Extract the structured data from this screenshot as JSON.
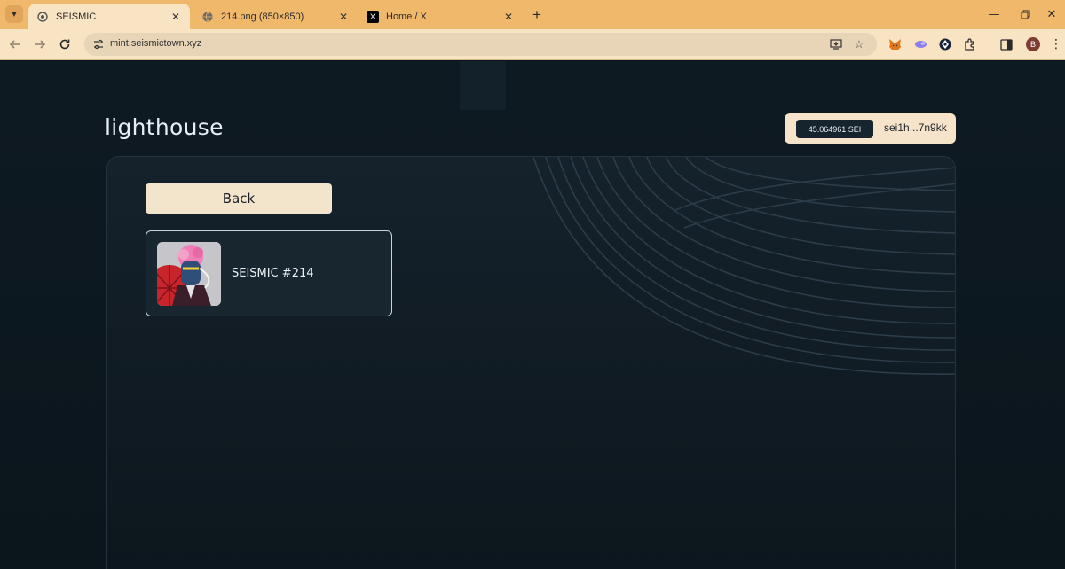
{
  "browser": {
    "tabs": [
      {
        "title": "SEISMIC",
        "active": true
      },
      {
        "title": "214.png (850×850)",
        "active": false
      },
      {
        "title": "Home / X",
        "active": false
      }
    ],
    "url": "mint.seismictown.xyz",
    "profile_initial": "B"
  },
  "app": {
    "logo": "lighthouse",
    "wallet": {
      "balance": "45.064961 SEI",
      "address": "sei1h...7n9kk"
    },
    "back_label": "Back",
    "nfts": [
      {
        "name": "SEISMIC #214"
      }
    ]
  },
  "colors": {
    "tabbar": "#efb86a",
    "toolbar": "#f8e3c3",
    "page_bg": "#0c161d",
    "accent_cream": "#f3e4cc"
  }
}
